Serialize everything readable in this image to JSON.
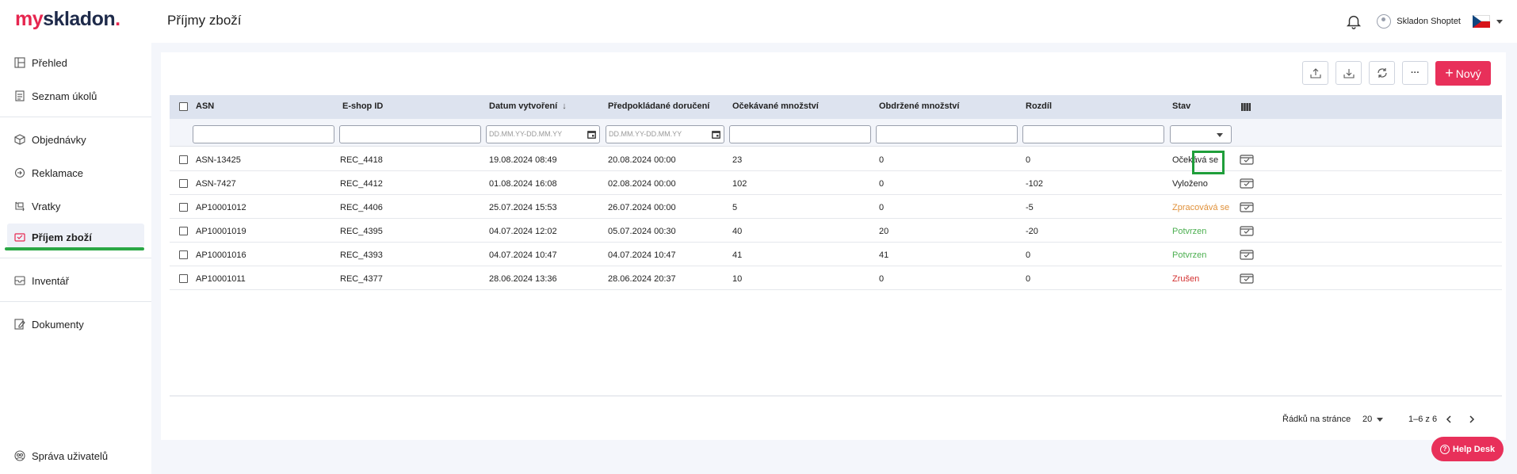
{
  "header": {
    "logo_my": "my",
    "logo_skladon": "skladon",
    "logo_dot": ".",
    "page_title": "Příjmy zboží",
    "user_name": "Skladon Shoptet"
  },
  "sidebar": {
    "items": [
      {
        "label": "Přehled",
        "icon": "dashboard-icon"
      },
      {
        "label": "Seznam úkolů",
        "icon": "tasks-icon"
      },
      {
        "label": "Objednávky",
        "icon": "box-icon"
      },
      {
        "label": "Reklamace",
        "icon": "return-icon"
      },
      {
        "label": "Vratky",
        "icon": "swap-icon"
      },
      {
        "label": "Příjem zboží",
        "icon": "receipt-icon",
        "active": true
      },
      {
        "label": "Inventář",
        "icon": "inbox-icon"
      },
      {
        "label": "Dokumenty",
        "icon": "document-edit-icon"
      }
    ],
    "bottom_item": {
      "label": "Správa uživatelů",
      "icon": "users-icon"
    }
  },
  "toolbar": {
    "new_label": "Nový",
    "new_plus": "+",
    "more_label": "···"
  },
  "table": {
    "columns": [
      "ASN",
      "E-shop ID",
      "Datum vytvoření",
      "Předpokládané doručení",
      "Očekávané množství",
      "Obdržené množství",
      "Rozdíl",
      "Stav"
    ],
    "date_placeholder": "DD.MM.YY-DD.MM.YY",
    "sort_indicator": "↓",
    "rows": [
      {
        "asn": "ASN-13425",
        "eshop": "REC_4418",
        "created": "19.08.2024 08:49",
        "delivery": "20.08.2024 00:00",
        "expected": "23",
        "received": "0",
        "diff": "0",
        "status": "Očekává se",
        "status_color": "#222222"
      },
      {
        "asn": "ASN-7427",
        "eshop": "REC_4412",
        "created": "01.08.2024 16:08",
        "delivery": "02.08.2024 00:00",
        "expected": "102",
        "received": "0",
        "diff": "-102",
        "status": "Vyloženo",
        "status_color": "#222222"
      },
      {
        "asn": "AP10001012",
        "eshop": "REC_4406",
        "created": "25.07.2024 15:53",
        "delivery": "26.07.2024 00:00",
        "expected": "5",
        "received": "0",
        "diff": "-5",
        "status": "Zpracovává se",
        "status_color": "#e0913a"
      },
      {
        "asn": "AP10001019",
        "eshop": "REC_4395",
        "created": "04.07.2024 12:02",
        "delivery": "05.07.2024 00:30",
        "expected": "40",
        "received": "20",
        "diff": "-20",
        "status": "Potvrzen",
        "status_color": "#4caf50"
      },
      {
        "asn": "AP10001016",
        "eshop": "REC_4393",
        "created": "04.07.2024 10:47",
        "delivery": "04.07.2024 10:47",
        "expected": "41",
        "received": "41",
        "diff": "0",
        "status": "Potvrzen",
        "status_color": "#4caf50"
      },
      {
        "asn": "AP10001011",
        "eshop": "REC_4377",
        "created": "28.06.2024 13:36",
        "delivery": "28.06.2024 20:37",
        "expected": "10",
        "received": "0",
        "diff": "0",
        "status": "Zrušen",
        "status_color": "#d32f2f"
      }
    ]
  },
  "footer": {
    "rows_per_page_label": "Řádků na stránce",
    "rows_per_page_value": "20",
    "range": "1–6 z 6"
  },
  "help": {
    "label": "Help Desk",
    "q": "?"
  },
  "colors": {
    "brand": "#e8305a",
    "navy": "#1e2a4a",
    "highlight": "#1f9e3a"
  }
}
